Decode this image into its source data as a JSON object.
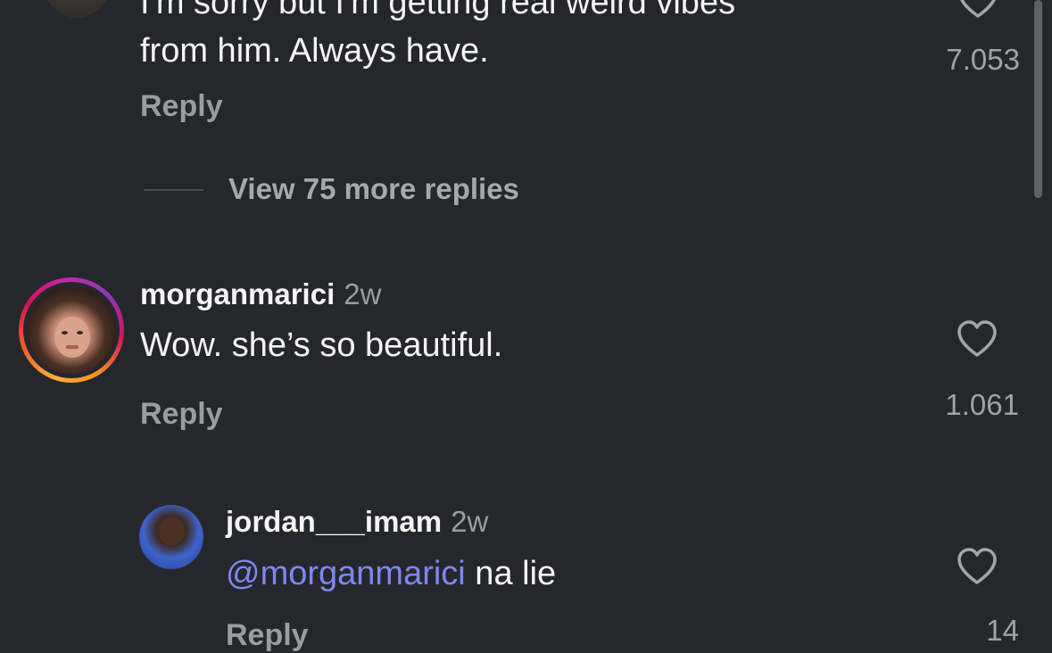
{
  "top_comment": {
    "text": "I'm sorry but I'm getting real weird vibes\nfrom him. Always have.",
    "likes": "7.053",
    "reply_label": "Reply",
    "view_more_replies": "View 75 more replies"
  },
  "morgan_comment": {
    "username": "morganmarici",
    "time": "2w",
    "text": "Wow. she’s so beautiful.",
    "likes": "1.061",
    "reply_label": "Reply",
    "has_story_ring": true
  },
  "jordan_reply": {
    "username": "jordan___imam",
    "time": "2w",
    "mention": "@morganmarici",
    "text": " na lie",
    "likes": "14",
    "reply_label": "Reply"
  },
  "icons": {
    "like": "heart-outline-icon"
  },
  "colors": {
    "background": "#25272c",
    "mention": "#7f86f2",
    "secondary_text": "#9a9ca1"
  }
}
